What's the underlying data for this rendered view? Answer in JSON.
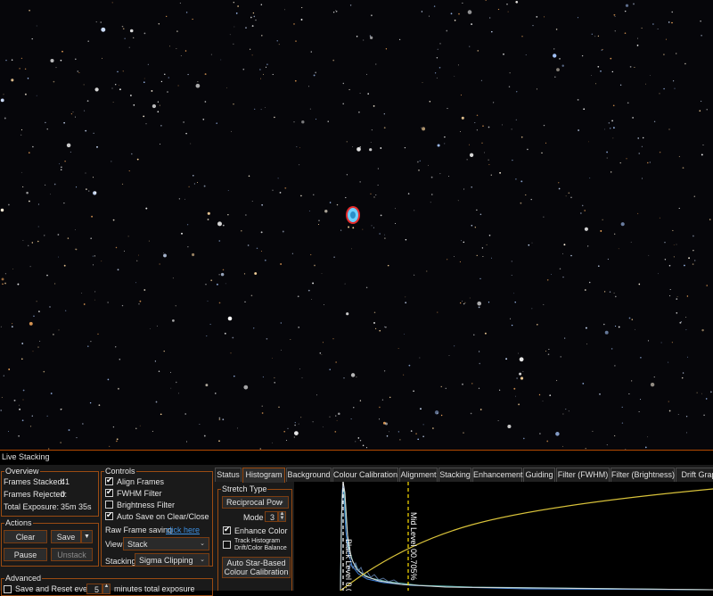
{
  "window": {
    "title": "Live Stacking"
  },
  "overview": {
    "legend": "Overview",
    "frames_stacked_label": "Frames Stacked:",
    "frames_stacked": "41",
    "frames_rejected_label": "Frames Rejected:",
    "frames_rejected": "0",
    "total_exposure_label": "Total Exposure:",
    "total_exposure": "35m 35s"
  },
  "actions": {
    "legend": "Actions",
    "clear": "Clear",
    "save": "Save",
    "pause": "Pause",
    "unstack": "Unstack"
  },
  "advanced": {
    "legend": "Advanced",
    "save_reset_label": "Save and Reset every",
    "minutes_value": "5",
    "minutes_suffix": "minutes total exposure"
  },
  "controls": {
    "legend": "Controls",
    "align_frames": "Align Frames",
    "align_frames_checked": true,
    "fwhm_filter": "FWHM Filter",
    "fwhm_filter_checked": true,
    "brightness_filter": "Brightness Filter",
    "brightness_filter_checked": false,
    "auto_save": "Auto Save on Clear/Close",
    "auto_save_checked": true,
    "raw_frame_label": "Raw Frame saving",
    "raw_frame_link": "click here",
    "view_label": "View",
    "view_value": "Stack",
    "stacking_label": "Stacking",
    "stacking_value": "Sigma Clipping"
  },
  "tabs": [
    "Status",
    "Histogram",
    "Background",
    "Colour Calibration",
    "Alignment",
    "Stacking",
    "Enhancement",
    "Guiding",
    "Filter (FWHM)",
    "Filter (Brightness)",
    "Drift Grap"
  ],
  "active_tab": "Histogram",
  "stretch": {
    "legend": "Stretch Type",
    "type_value": "Reciprocal Pow",
    "mode_label": "Mode",
    "mode_value": "3",
    "enhance_color": "Enhance Color",
    "enhance_color_checked": true,
    "track_histogram": "Track Histogram Drift/Color Balance",
    "track_histogram_checked": false,
    "auto_button": "Auto Star-Based Colour Calibration"
  },
  "histogram": {
    "black_level_label": "Black Level 0.0",
    "mid_level_label": "Mid Level 00.705%"
  },
  "colors": {
    "accent": "#9a4b12",
    "curve": "#d8c23a",
    "link": "#3c8fe0"
  }
}
